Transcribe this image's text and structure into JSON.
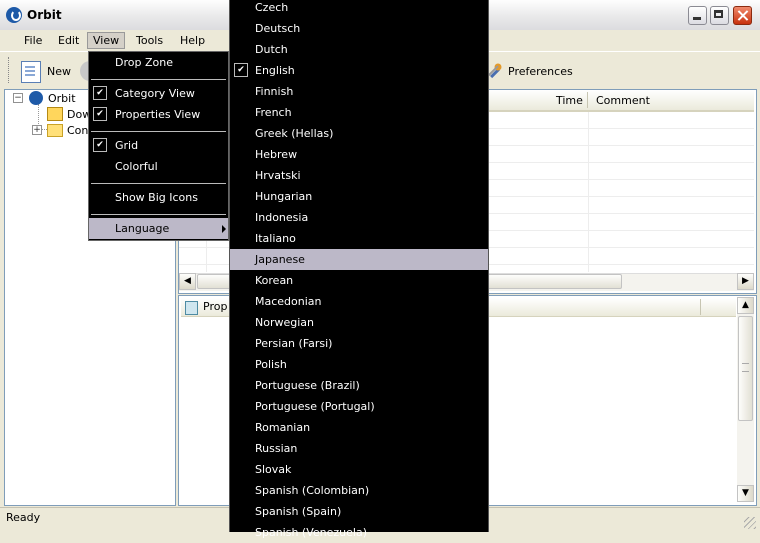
{
  "window": {
    "title": "Orbit"
  },
  "menubar": {
    "file": "File",
    "edit": "Edit",
    "view": "View",
    "tools": "Tools",
    "help": "Help"
  },
  "toolbar": {
    "new_label": "New",
    "preferences_label": "Preferences"
  },
  "tree": {
    "root": "Orbit",
    "download": "Dow",
    "con": "Con"
  },
  "list": {
    "col_time": "Time",
    "col_comment": "Comment"
  },
  "properties": {
    "tab": "Prop"
  },
  "status": {
    "text": "Ready"
  },
  "view_menu": {
    "drop_zone": "Drop Zone",
    "category_view": "Category View",
    "properties_view": "Properties View",
    "grid": "Grid",
    "colorful": "Colorful",
    "show_big_icons": "Show Big Icons",
    "language": "Language",
    "check_mark": "✔"
  },
  "language_menu": {
    "items": [
      "Czech",
      "Deutsch",
      "Dutch",
      "English",
      "Finnish",
      "French",
      "Greek (Hellas)",
      "Hebrew",
      "Hrvatski",
      "Hungarian",
      "Indonesia",
      "Italiano",
      "Japanese",
      "Korean",
      "Macedonian",
      "Norwegian",
      "Persian (Farsi)",
      "Polish",
      "Portuguese (Brazil)",
      "Portuguese (Portugal)",
      "Romanian",
      "Russian",
      "Slovak",
      "Spanish (Colombian)",
      "Spanish (Spain)",
      "Spanish (Venezuela)"
    ],
    "checked": "English",
    "highlighted": "Japanese"
  },
  "colors": {
    "menu_bg": "#000000",
    "highlight": "#bcb8c8",
    "chrome": "#ece9d8"
  }
}
